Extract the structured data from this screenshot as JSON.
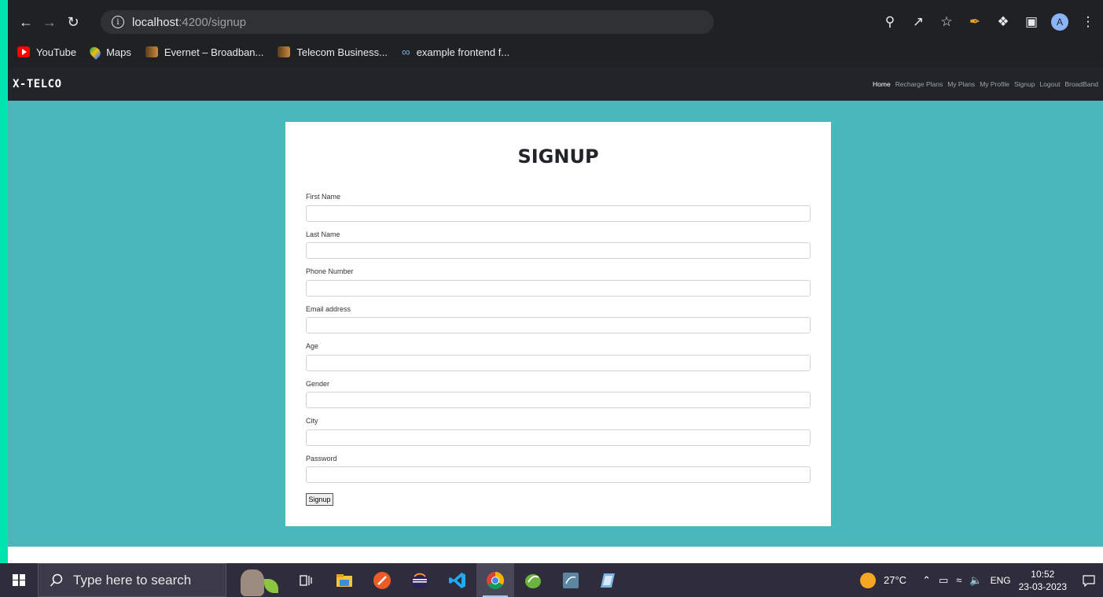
{
  "browser": {
    "url_host": "localhost",
    "url_path": ":4200/signup",
    "bookmarks": [
      {
        "label": "YouTube",
        "icon": "youtube-icon"
      },
      {
        "label": "Maps",
        "icon": "maps-icon"
      },
      {
        "label": "Evernet – Broadban...",
        "icon": "site-icon"
      },
      {
        "label": "Telecom Business...",
        "icon": "site-icon"
      },
      {
        "label": "example frontend f...",
        "icon": "link-icon"
      }
    ],
    "profile_initial": "A"
  },
  "navbar": {
    "brand": "X-TELCO",
    "links": [
      "Home",
      "Recharge Plans",
      "My Plans",
      "My Profile",
      "Signup",
      "Logout",
      "BroadBand"
    ]
  },
  "form": {
    "title": "SIGNUP",
    "fields": [
      {
        "label": "First Name",
        "value": ""
      },
      {
        "label": "Last Name",
        "value": ""
      },
      {
        "label": "Phone Number",
        "value": ""
      },
      {
        "label": "Email address",
        "value": ""
      },
      {
        "label": "Age",
        "value": ""
      },
      {
        "label": "Gender",
        "value": ""
      },
      {
        "label": "City",
        "value": ""
      },
      {
        "label": "Password",
        "value": ""
      }
    ],
    "submit_label": "Signup"
  },
  "taskbar": {
    "search_placeholder": "Type here to search",
    "temperature": "27°C",
    "language": "ENG",
    "time": "10:52",
    "date": "23-03-2023"
  }
}
